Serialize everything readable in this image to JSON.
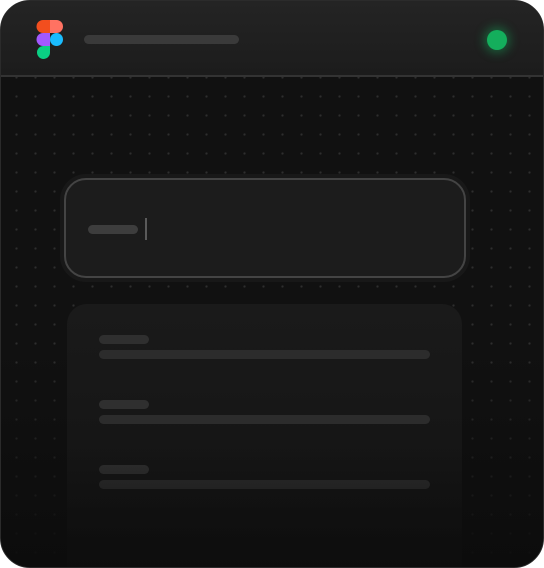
{
  "app": {
    "logo_icon": "figma-logo-icon",
    "status_color": "#14ae5c"
  },
  "search": {
    "value": "",
    "placeholder": ""
  },
  "results": [
    {
      "title": "",
      "line": ""
    },
    {
      "title": "",
      "line": ""
    },
    {
      "title": "",
      "line": ""
    }
  ]
}
